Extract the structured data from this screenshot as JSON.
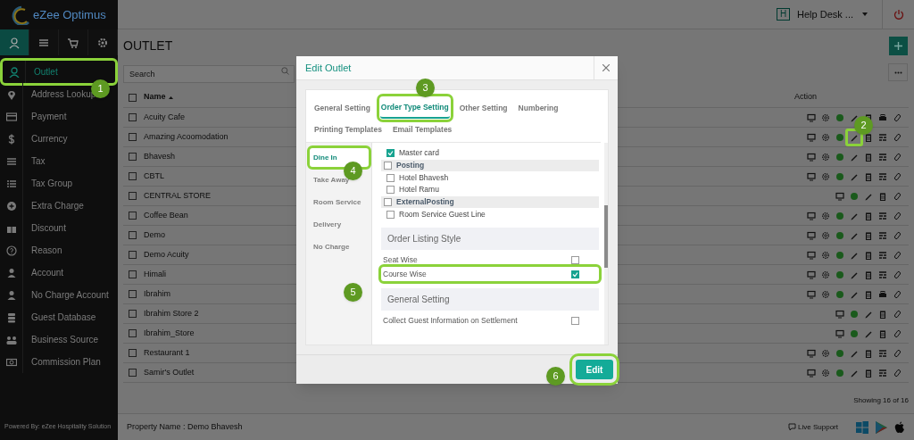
{
  "sidebar": {
    "logo": "eZee Optimus",
    "menu_tabs": [
      {
        "selected": true
      },
      {
        "selected": false
      },
      {
        "selected": false
      },
      {
        "selected": false
      }
    ],
    "items": [
      {
        "label": "Outlet",
        "selected": true
      },
      {
        "label": "Address Lookup",
        "selected": false
      },
      {
        "label": "Payment",
        "selected": false
      },
      {
        "label": "Currency",
        "selected": false
      },
      {
        "label": "Tax",
        "selected": false
      },
      {
        "label": "Tax Group",
        "selected": false
      },
      {
        "label": "Extra Charge",
        "selected": false
      },
      {
        "label": "Discount",
        "selected": false
      },
      {
        "label": "Reason",
        "selected": false
      },
      {
        "label": "Account",
        "selected": false
      },
      {
        "label": "No Charge Account",
        "selected": false
      },
      {
        "label": "Guest Database",
        "selected": false
      },
      {
        "label": "Business Source",
        "selected": false
      },
      {
        "label": "Commission Plan",
        "selected": false
      }
    ],
    "footer": "Powered By: eZee Hospitality Solution"
  },
  "header": {
    "badge": "H",
    "user": "Help Desk ..."
  },
  "page": {
    "title": "OUTLET",
    "search": {
      "placeholder": "Search"
    },
    "select_all": {
      "checked": false
    },
    "columns": [
      "Name",
      "Action"
    ],
    "rows": [
      {
        "name": "Acuity Cafe",
        "checked": false,
        "actions": [
          {
            "kind": "monitor"
          },
          {
            "kind": "gear"
          },
          {
            "kind": "status"
          },
          {
            "kind": "edit"
          },
          {
            "kind": "delete"
          },
          {
            "kind": "printer"
          },
          {
            "kind": "link"
          }
        ]
      },
      {
        "name": "Amazing Acoomodation",
        "checked": false,
        "actions": [
          {
            "kind": "monitor"
          },
          {
            "kind": "gear"
          },
          {
            "kind": "status"
          },
          {
            "kind": "edit"
          },
          {
            "kind": "delete"
          },
          {
            "kind": "layout"
          },
          {
            "kind": "link"
          }
        ]
      },
      {
        "name": "Bhavesh",
        "checked": false,
        "actions": [
          {
            "kind": "monitor"
          },
          {
            "kind": "gear"
          },
          {
            "kind": "status"
          },
          {
            "kind": "edit"
          },
          {
            "kind": "delete"
          },
          {
            "kind": "layout"
          },
          {
            "kind": "link"
          }
        ]
      },
      {
        "name": "CBTL",
        "checked": false,
        "actions": [
          {
            "kind": "monitor"
          },
          {
            "kind": "gear"
          },
          {
            "kind": "status"
          },
          {
            "kind": "edit"
          },
          {
            "kind": "delete"
          },
          {
            "kind": "layout"
          },
          {
            "kind": "link"
          }
        ]
      },
      {
        "name": "CENTRAL STORE",
        "checked": false,
        "actions": [
          {
            "kind": "monitor"
          },
          {
            "kind": "status"
          },
          {
            "kind": "edit"
          },
          {
            "kind": "delete"
          },
          {
            "kind": "link"
          }
        ]
      },
      {
        "name": "Coffee Bean",
        "checked": false,
        "actions": [
          {
            "kind": "monitor"
          },
          {
            "kind": "gear"
          },
          {
            "kind": "status"
          },
          {
            "kind": "edit"
          },
          {
            "kind": "delete"
          },
          {
            "kind": "layout"
          },
          {
            "kind": "link"
          }
        ]
      },
      {
        "name": "Demo",
        "checked": false,
        "actions": [
          {
            "kind": "monitor"
          },
          {
            "kind": "gear"
          },
          {
            "kind": "status"
          },
          {
            "kind": "edit"
          },
          {
            "kind": "delete"
          },
          {
            "kind": "layout"
          },
          {
            "kind": "link"
          }
        ]
      },
      {
        "name": "Demo Acuity",
        "checked": false,
        "actions": [
          {
            "kind": "monitor"
          },
          {
            "kind": "gear"
          },
          {
            "kind": "status"
          },
          {
            "kind": "edit"
          },
          {
            "kind": "delete"
          },
          {
            "kind": "layout"
          },
          {
            "kind": "link"
          }
        ]
      },
      {
        "name": "Himali",
        "checked": false,
        "actions": [
          {
            "kind": "monitor"
          },
          {
            "kind": "gear"
          },
          {
            "kind": "status"
          },
          {
            "kind": "edit"
          },
          {
            "kind": "delete"
          },
          {
            "kind": "layout"
          },
          {
            "kind": "link"
          }
        ]
      },
      {
        "name": "Ibrahim",
        "checked": false,
        "actions": [
          {
            "kind": "monitor"
          },
          {
            "kind": "gear"
          },
          {
            "kind": "status"
          },
          {
            "kind": "edit"
          },
          {
            "kind": "delete"
          },
          {
            "kind": "printer"
          },
          {
            "kind": "link"
          }
        ]
      },
      {
        "name": "Ibrahim Store 2",
        "checked": false,
        "actions": [
          {
            "kind": "monitor"
          },
          {
            "kind": "status"
          },
          {
            "kind": "edit"
          },
          {
            "kind": "delete"
          },
          {
            "kind": "link"
          }
        ]
      },
      {
        "name": "Ibrahim_Store",
        "checked": false,
        "actions": [
          {
            "kind": "monitor"
          },
          {
            "kind": "status"
          },
          {
            "kind": "edit"
          },
          {
            "kind": "delete"
          },
          {
            "kind": "link"
          }
        ]
      },
      {
        "name": "Restaurant 1",
        "checked": false,
        "actions": [
          {
            "kind": "monitor"
          },
          {
            "kind": "gear"
          },
          {
            "kind": "status"
          },
          {
            "kind": "edit"
          },
          {
            "kind": "delete"
          },
          {
            "kind": "layout"
          },
          {
            "kind": "link"
          }
        ]
      },
      {
        "name": "Samir's Outlet",
        "checked": false,
        "actions": [
          {
            "kind": "monitor"
          },
          {
            "kind": "gear"
          },
          {
            "kind": "status"
          },
          {
            "kind": "edit"
          },
          {
            "kind": "delete"
          },
          {
            "kind": "layout"
          },
          {
            "kind": "link"
          }
        ]
      }
    ],
    "showing": "Showing 16 of 16"
  },
  "status_bar": {
    "property": "Property Name : Demo Bhavesh",
    "support": "Live Support"
  },
  "modal": {
    "title": "Edit Outlet",
    "tabs": [
      {
        "label": "General Setting",
        "selected": false
      },
      {
        "label": "Order Type Setting",
        "selected": true
      },
      {
        "label": "Other Setting",
        "selected": false
      },
      {
        "label": "Numbering",
        "selected": false
      },
      {
        "label": "Printing Templates",
        "selected": false
      },
      {
        "label": "Email Templates",
        "selected": false
      }
    ],
    "order_types": [
      {
        "label": "Dine In",
        "selected": true
      },
      {
        "label": "Take Away",
        "selected": false
      },
      {
        "label": "Room Service",
        "selected": false
      },
      {
        "label": "Delivery",
        "selected": false
      },
      {
        "label": "No Charge",
        "selected": false
      }
    ],
    "settings": [
      {
        "kind": "item",
        "label": "Master card",
        "checked": true
      },
      {
        "kind": "group",
        "label": "Posting",
        "checked": false
      },
      {
        "kind": "item",
        "label": "Hotel Bhavesh",
        "checked": false
      },
      {
        "kind": "item",
        "label": "Hotel Ramu",
        "checked": false
      },
      {
        "kind": "group",
        "label": "ExternalPosting",
        "checked": false
      },
      {
        "kind": "item",
        "label": "Room Service Guest Line",
        "checked": false
      },
      {
        "kind": "section",
        "label": "Order Listing Style"
      },
      {
        "kind": "option",
        "label": "Seat Wise",
        "checked": false
      },
      {
        "kind": "option",
        "label": "Course Wise",
        "checked": true
      },
      {
        "kind": "section",
        "label": "General Setting"
      },
      {
        "kind": "option",
        "label": "Collect Guest Information on Settlement",
        "checked": false
      }
    ],
    "button": "Edit"
  },
  "callouts": [
    {
      "label": "1"
    },
    {
      "label": "2"
    },
    {
      "label": "3"
    },
    {
      "label": "4"
    },
    {
      "label": "5"
    },
    {
      "label": "6"
    }
  ]
}
